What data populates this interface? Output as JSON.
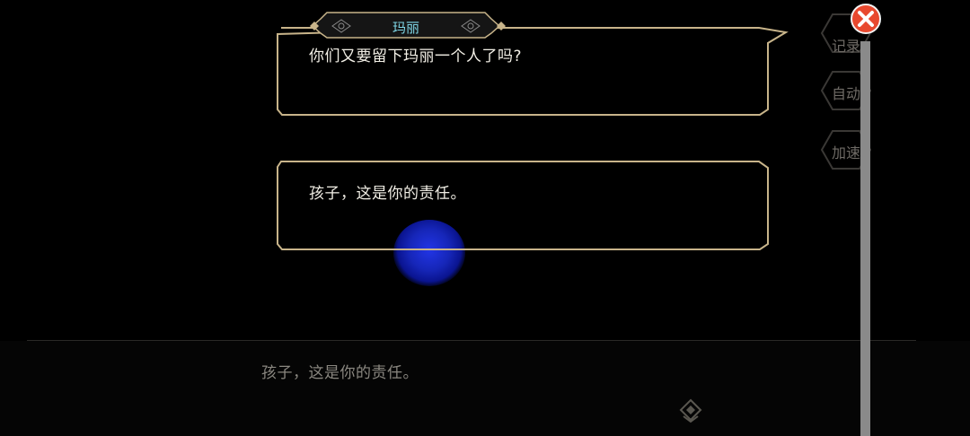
{
  "dialog": {
    "speaker_name": "玛丽",
    "line_1": "你们又要留下玛丽一个人了吗?",
    "line_2": "孩子，这是你的责任。"
  },
  "bottom_bar": {
    "current_text": "孩子，这是你的责任。"
  },
  "side_menu": {
    "log_label": "记录",
    "auto_label": "自动",
    "speed_label": "加速"
  },
  "colors": {
    "frame": "#c8b48a",
    "speaker_name": "#7fd6e6",
    "close_button": "#e8482e",
    "orb": "#1626b8"
  },
  "icons": {
    "close": "close-icon",
    "next": "next-diamond-icon"
  }
}
